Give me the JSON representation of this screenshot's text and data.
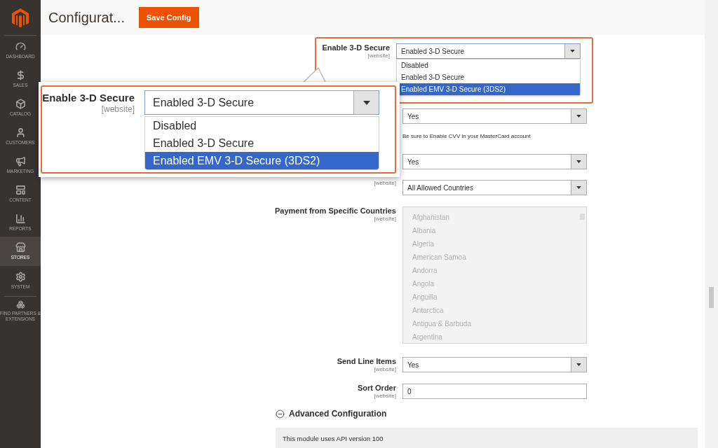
{
  "header": {
    "title": "Configurat...",
    "save_button": "Save Config"
  },
  "sidebar": {
    "items": [
      {
        "label": "DASHBOARD",
        "selected": false
      },
      {
        "label": "SALES",
        "selected": false
      },
      {
        "label": "CATALOG",
        "selected": false
      },
      {
        "label": "CUSTOMERS",
        "selected": false
      },
      {
        "label": "MARKETING",
        "selected": false
      },
      {
        "label": "CONTENT",
        "selected": false
      },
      {
        "label": "REPORTS",
        "selected": false
      },
      {
        "label": "STORES",
        "selected": true
      },
      {
        "label": "SYSTEM",
        "selected": false
      },
      {
        "label": "FIND PARTNERS & EXTENSIONS",
        "selected": false
      }
    ]
  },
  "highlighted_field": {
    "label": "Enable 3-D Secure",
    "scope": "[website]",
    "value": "Enabled 3-D Secure",
    "options": [
      {
        "label": "Disabled",
        "highlighted": false
      },
      {
        "label": "Enabled 3-D Secure",
        "highlighted": false
      },
      {
        "label": "Enabled EMV 3-D Secure (3DS2)",
        "highlighted": true
      }
    ]
  },
  "fields": [
    {
      "kind": "select",
      "value": "Yes",
      "note": "Be sure to Enable CVV in your MasterCard account"
    },
    {
      "kind": "select",
      "value": "Yes"
    },
    {
      "kind": "select",
      "scope": "[website]",
      "value": "All Allowed Countries"
    },
    {
      "kind": "multiselect",
      "label": "Payment from Specific Countries",
      "scope": "[website]",
      "disabled": true,
      "options": [
        "Afghanistan",
        "Albania",
        "Algeria",
        "American Samoa",
        "Andorra",
        "Angola",
        "Anguilla",
        "Antarctica",
        "Antigua & Barbuda",
        "Argentina"
      ]
    },
    {
      "kind": "select",
      "label": "Send Line Items",
      "scope": "[website]",
      "value": "Yes"
    },
    {
      "kind": "text",
      "label": "Sort Order",
      "scope": "[website]",
      "value": "0"
    }
  ],
  "advanced_section": {
    "title": "Advanced Configuration",
    "expanded": true,
    "message": "This module uses API version 100"
  },
  "zoom_callout": {
    "label": "Enable 3-D Secure",
    "scope": "[website]",
    "value": "Enabled 3-D Secure",
    "options": [
      {
        "label": "Disabled",
        "highlighted": false
      },
      {
        "label": "Enabled 3-D Secure",
        "highlighted": false
      },
      {
        "label": "Enabled EMV 3-D Secure (3DS2)",
        "highlighted": true
      }
    ]
  }
}
